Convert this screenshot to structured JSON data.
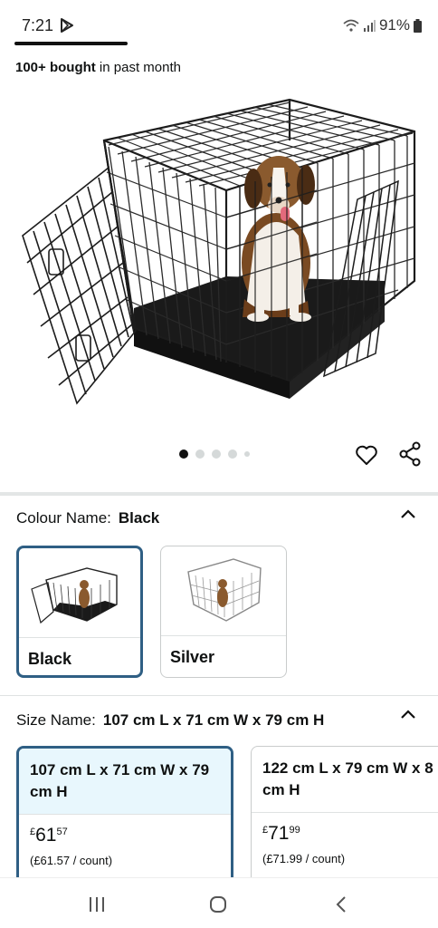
{
  "status_bar": {
    "time": "7:21",
    "battery": "91%"
  },
  "bought": {
    "count": "100+ bought",
    "suffix": " in past month"
  },
  "colour": {
    "label": "Colour Name:",
    "value": "Black",
    "options": [
      {
        "label": "Black"
      },
      {
        "label": "Silver"
      }
    ]
  },
  "size": {
    "label": "Size Name:",
    "value": "107 cm L x 71 cm W x 79 cm H",
    "options": [
      {
        "name": "107 cm L x 71 cm W x 79 cm H",
        "currency": "£",
        "whole": "61",
        "fraction": "57",
        "per_count": "(£61.57 / count)"
      },
      {
        "name": "122 cm L x 79 cm W x 8 cm H",
        "currency": "£",
        "whole": "71",
        "fraction": "99",
        "per_count": "(£71.99 / count)"
      }
    ]
  },
  "gallery": {
    "image_count": 5,
    "active_index": 0
  },
  "icons": {
    "wishlist": "heart-icon",
    "share": "share-icon",
    "expand": "chevron-up-icon",
    "nav_recent": "recent-apps-icon",
    "nav_home": "home-icon",
    "nav_back": "back-icon"
  },
  "colors": {
    "selected_border": "#2f5f84",
    "selected_fill": "#e8f7fd"
  }
}
